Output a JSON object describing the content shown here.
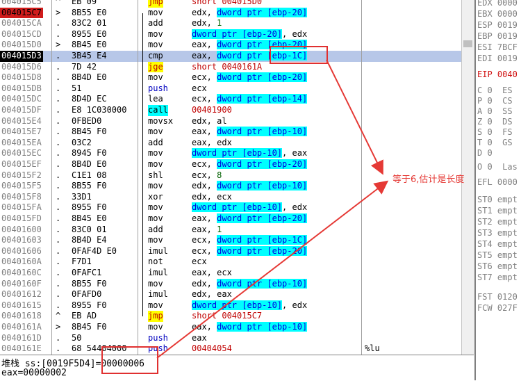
{
  "disasm": {
    "rows": [
      {
        "addr": "004015C5",
        "mark": "^",
        "bytes": "EB 09",
        "mn": "jmp",
        "mn_style": "hl",
        "ops": [
          {
            "t": "short 004015D0",
            "c": "tgt"
          }
        ],
        "cmt": ""
      },
      {
        "addr": "004015C7",
        "mark": ">",
        "bytes": "8B55 E0",
        "mn": "mov",
        "mn_style": "",
        "ops": [
          {
            "t": "edx, "
          },
          {
            "t": "dword ptr [ebp-20]",
            "c": "mem"
          }
        ],
        "cmt": ""
      },
      {
        "addr": "004015CA",
        "mark": ".",
        "bytes": "83C2 01",
        "mn": "add",
        "mn_style": "",
        "ops": [
          {
            "t": "edx, "
          },
          {
            "t": "1",
            "c": "n"
          }
        ],
        "cmt": ""
      },
      {
        "addr": "004015CD",
        "mark": ".",
        "bytes": "8955 E0",
        "mn": "mov",
        "mn_style": "",
        "ops": [
          {
            "t": "dword ptr [ebp-20]",
            "c": "mem"
          },
          {
            "t": ", edx"
          }
        ],
        "cmt": ""
      },
      {
        "addr": "004015D0",
        "mark": ">",
        "bytes": "8B45 E0",
        "mn": "mov",
        "mn_style": "",
        "ops": [
          {
            "t": "eax, "
          },
          {
            "t": "dword ptr [ebp-20]",
            "c": "mem"
          }
        ],
        "cmt": ""
      },
      {
        "addr": "004015D3",
        "mark": ".",
        "bytes": "3B45 E4",
        "mn": "cmp",
        "mn_style": "",
        "ops": [
          {
            "t": "eax, "
          },
          {
            "t": "dword ptr [ebp-1C]",
            "c": "mem"
          }
        ],
        "cmt": ""
      },
      {
        "addr": "004015D6",
        "mark": ".",
        "bytes": "7D 42",
        "mn": "jge",
        "mn_style": "hl",
        "ops": [
          {
            "t": "short 0040161A",
            "c": "tgt"
          }
        ],
        "cmt": ""
      },
      {
        "addr": "004015D8",
        "mark": ".",
        "bytes": "8B4D E0",
        "mn": "mov",
        "mn_style": "",
        "ops": [
          {
            "t": "ecx, "
          },
          {
            "t": "dword ptr [ebp-20]",
            "c": "mem"
          }
        ],
        "cmt": ""
      },
      {
        "addr": "004015DB",
        "mark": ".",
        "bytes": "51",
        "mn": "push",
        "mn_style": "blue",
        "ops": [
          {
            "t": "ecx"
          }
        ],
        "cmt": ""
      },
      {
        "addr": "004015DC",
        "mark": ".",
        "bytes": "8D4D EC",
        "mn": "lea",
        "mn_style": "",
        "ops": [
          {
            "t": "ecx, "
          },
          {
            "t": "dword ptr [ebp-14]",
            "c": "mem"
          }
        ],
        "cmt": ""
      },
      {
        "addr": "004015DF",
        "mark": ".",
        "bytes": "E8 1C030000",
        "mn": "call",
        "mn_style": "call",
        "ops": [
          {
            "t": "00401900",
            "c": "tgt"
          }
        ],
        "cmt": ""
      },
      {
        "addr": "004015E4",
        "mark": ".",
        "bytes": "0FBED0",
        "mn": "movsx",
        "mn_style": "",
        "ops": [
          {
            "t": "edx, al"
          }
        ],
        "cmt": ""
      },
      {
        "addr": "004015E7",
        "mark": ".",
        "bytes": "8B45 F0",
        "mn": "mov",
        "mn_style": "",
        "ops": [
          {
            "t": "eax, "
          },
          {
            "t": "dword ptr [ebp-10]",
            "c": "mem"
          }
        ],
        "cmt": ""
      },
      {
        "addr": "004015EA",
        "mark": ".",
        "bytes": "03C2",
        "mn": "add",
        "mn_style": "",
        "ops": [
          {
            "t": "eax, edx"
          }
        ],
        "cmt": ""
      },
      {
        "addr": "004015EC",
        "mark": ".",
        "bytes": "8945 F0",
        "mn": "mov",
        "mn_style": "",
        "ops": [
          {
            "t": "dword ptr [ebp-10]",
            "c": "mem"
          },
          {
            "t": ", eax"
          }
        ],
        "cmt": ""
      },
      {
        "addr": "004015EF",
        "mark": ".",
        "bytes": "8B4D E0",
        "mn": "mov",
        "mn_style": "",
        "ops": [
          {
            "t": "ecx, "
          },
          {
            "t": "dword ptr [ebp-20]",
            "c": "mem"
          }
        ],
        "cmt": ""
      },
      {
        "addr": "004015F2",
        "mark": ".",
        "bytes": "C1E1 08",
        "mn": "shl",
        "mn_style": "",
        "ops": [
          {
            "t": "ecx, "
          },
          {
            "t": "8",
            "c": "n"
          }
        ],
        "cmt": ""
      },
      {
        "addr": "004015F5",
        "mark": ".",
        "bytes": "8B55 F0",
        "mn": "mov",
        "mn_style": "",
        "ops": [
          {
            "t": "edx, "
          },
          {
            "t": "dword ptr [ebp-10]",
            "c": "mem"
          }
        ],
        "cmt": ""
      },
      {
        "addr": "004015F8",
        "mark": ".",
        "bytes": "33D1",
        "mn": "xor",
        "mn_style": "",
        "ops": [
          {
            "t": "edx, ecx"
          }
        ],
        "cmt": ""
      },
      {
        "addr": "004015FA",
        "mark": ".",
        "bytes": "8955 F0",
        "mn": "mov",
        "mn_style": "",
        "ops": [
          {
            "t": "dword ptr [ebp-10]",
            "c": "mem"
          },
          {
            "t": ", edx"
          }
        ],
        "cmt": ""
      },
      {
        "addr": "004015FD",
        "mark": ".",
        "bytes": "8B45 E0",
        "mn": "mov",
        "mn_style": "",
        "ops": [
          {
            "t": "eax, "
          },
          {
            "t": "dword ptr [ebp-20]",
            "c": "mem"
          }
        ],
        "cmt": ""
      },
      {
        "addr": "00401600",
        "mark": ".",
        "bytes": "83C0 01",
        "mn": "add",
        "mn_style": "",
        "ops": [
          {
            "t": "eax, "
          },
          {
            "t": "1",
            "c": "n"
          }
        ],
        "cmt": ""
      },
      {
        "addr": "00401603",
        "mark": ".",
        "bytes": "8B4D E4",
        "mn": "mov",
        "mn_style": "",
        "ops": [
          {
            "t": "ecx, "
          },
          {
            "t": "dword ptr [ebp-1C]",
            "c": "mem"
          }
        ],
        "cmt": ""
      },
      {
        "addr": "00401606",
        "mark": ".",
        "bytes": "0FAF4D E0",
        "mn": "imul",
        "mn_style": "",
        "ops": [
          {
            "t": "ecx, "
          },
          {
            "t": "dword ptr [ebp-20]",
            "c": "mem"
          }
        ],
        "cmt": ""
      },
      {
        "addr": "0040160A",
        "mark": ".",
        "bytes": "F7D1",
        "mn": "not",
        "mn_style": "",
        "ops": [
          {
            "t": "ecx"
          }
        ],
        "cmt": ""
      },
      {
        "addr": "0040160C",
        "mark": ".",
        "bytes": "0FAFC1",
        "mn": "imul",
        "mn_style": "",
        "ops": [
          {
            "t": "eax, ecx"
          }
        ],
        "cmt": ""
      },
      {
        "addr": "0040160F",
        "mark": ".",
        "bytes": "8B55 F0",
        "mn": "mov",
        "mn_style": "",
        "ops": [
          {
            "t": "edx, "
          },
          {
            "t": "dword ptr [ebp-10]",
            "c": "mem"
          }
        ],
        "cmt": ""
      },
      {
        "addr": "00401612",
        "mark": ".",
        "bytes": "0FAFD0",
        "mn": "imul",
        "mn_style": "",
        "ops": [
          {
            "t": "edx, eax"
          }
        ],
        "cmt": ""
      },
      {
        "addr": "00401615",
        "mark": ".",
        "bytes": "8955 F0",
        "mn": "mov",
        "mn_style": "",
        "ops": [
          {
            "t": "dword ptr [ebp-10]",
            "c": "mem"
          },
          {
            "t": ", edx"
          }
        ],
        "cmt": ""
      },
      {
        "addr": "00401618",
        "mark": "^",
        "bytes": "EB AD",
        "mn": "jmp",
        "mn_style": "hl",
        "ops": [
          {
            "t": "short 004015C7",
            "c": "tgt"
          }
        ],
        "cmt": ""
      },
      {
        "addr": "0040161A",
        "mark": ">",
        "bytes": "8B45 F0",
        "mn": "mov",
        "mn_style": "",
        "ops": [
          {
            "t": "eax, "
          },
          {
            "t": "dword ptr [ebp-10]",
            "c": "mem"
          }
        ],
        "cmt": ""
      },
      {
        "addr": "0040161D",
        "mark": ".",
        "bytes": "50",
        "mn": "push",
        "mn_style": "blue",
        "ops": [
          {
            "t": "eax"
          }
        ],
        "cmt": ""
      },
      {
        "addr": "0040161E",
        "mark": ".",
        "bytes": "68 54404000",
        "mn": "push",
        "mn_style": "blue",
        "ops": [
          {
            "t": "00404054",
            "c": "tgt"
          }
        ],
        "cmt": "%lu"
      }
    ]
  },
  "registers": [
    {
      "label": "EDX 0000",
      "red": false
    },
    {
      "label": "EBX 0000",
      "red": false
    },
    {
      "label": "ESP 0019",
      "red": false
    },
    {
      "label": "EBP 0019",
      "red": false
    },
    {
      "label": "ESI 7BCF",
      "red": false
    },
    {
      "label": "EDI 0019",
      "red": false
    },
    {
      "label": "EIP 0040",
      "red": true
    },
    {
      "label": "C 0  ES",
      "red": false
    },
    {
      "label": "P 0  CS",
      "red": false
    },
    {
      "label": "A 0  SS",
      "red": false
    },
    {
      "label": "Z 0  DS",
      "red": false
    },
    {
      "label": "S 0  FS",
      "red": false
    },
    {
      "label": "T 0  GS",
      "red": false
    },
    {
      "label": "D 0",
      "red": false
    },
    {
      "label": "O 0  Las",
      "red": false
    },
    {
      "label": "EFL 0000",
      "red": false
    },
    {
      "label": "ST0 empt",
      "red": false
    },
    {
      "label": "ST1 empt",
      "red": false
    },
    {
      "label": "ST2 empt",
      "red": false
    },
    {
      "label": "ST3 empt",
      "red": false
    },
    {
      "label": "ST4 empt",
      "red": false
    },
    {
      "label": "ST5 empt",
      "red": false
    },
    {
      "label": "ST6 empt",
      "red": false
    },
    {
      "label": "ST7 empt",
      "red": false
    },
    {
      "label": "FST 0120",
      "red": false
    },
    {
      "label": "FCW 027F",
      "red": false
    }
  ],
  "info": {
    "line1": "堆栈 ss:[0019F5D4]=00000006",
    "line2": "eax=00000002"
  },
  "annotation": {
    "text": "等于6,估计是长度"
  },
  "colors": {
    "eip_highlight": "#d01c1c",
    "selected_row": "#b7c7e8",
    "annotation": "#e53935"
  }
}
